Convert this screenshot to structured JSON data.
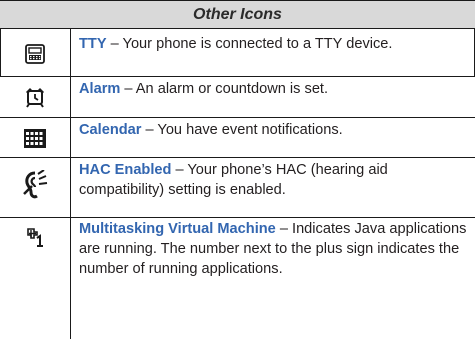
{
  "header": {
    "title": "Other Icons"
  },
  "rows": [
    {
      "icon": "tty-icon",
      "term": "TTY",
      "dash": " – ",
      "desc": "Your phone is connected to a TTY device."
    },
    {
      "icon": "alarm-clock-icon",
      "term": "Alarm",
      "dash": " – ",
      "desc": "An alarm or countdown is set."
    },
    {
      "icon": "calendar-icon",
      "term": "Calendar",
      "dash": " – ",
      "desc": "You have event notifications."
    },
    {
      "icon": "hac-hearing-aid-icon",
      "term": "HAC Enabled",
      "dash": " – ",
      "desc": "Your phone’s HAC (hearing aid compatibility) setting is enabled."
    },
    {
      "icon": "multitasking-icon",
      "term": "Multitasking Virtual Machine",
      "dash": " – ",
      "desc": "Indicates Java applications are running. The number next to the plus sign indicates the number of running applications."
    }
  ]
}
